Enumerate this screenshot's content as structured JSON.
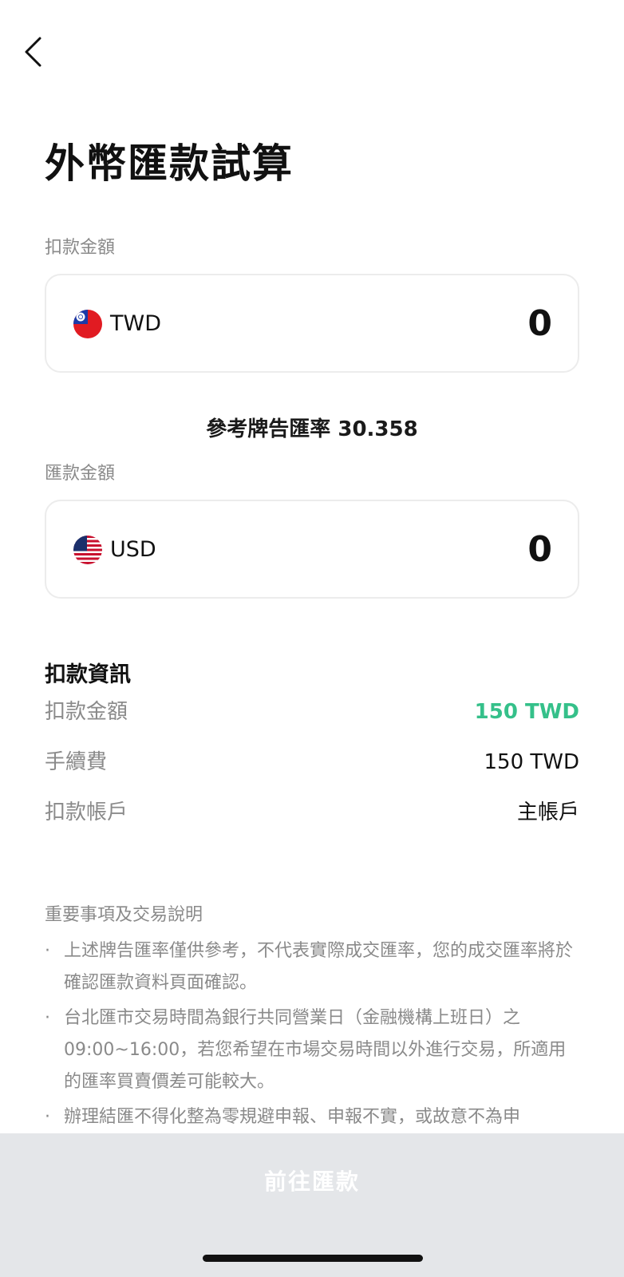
{
  "header": {
    "title": "外幣匯款試算"
  },
  "debit": {
    "label": "扣款金額",
    "currency": "TWD",
    "amount": "0",
    "flag": "taiwan-flag-icon"
  },
  "rate": {
    "text": "參考牌告匯率 30.358"
  },
  "remit": {
    "label": "匯款金額",
    "currency": "USD",
    "amount": "0",
    "flag": "usa-flag-icon"
  },
  "debit_info": {
    "heading": "扣款資訊",
    "rows": [
      {
        "label": "扣款金額",
        "value": "150 TWD"
      },
      {
        "label": "手續費",
        "value": "150 TWD"
      },
      {
        "label": "扣款帳戶",
        "value": "主帳戶"
      }
    ]
  },
  "notes": {
    "title": "重要事項及交易說明",
    "bullet": "·",
    "items": [
      "上述牌告匯率僅供參考，不代表實際成交匯率，您的成交匯率將於確認匯款資料頁面確認。",
      "台北匯市交易時間為銀行共同營業日（金融機構上班日）之09:00~16:00，若您希望在市場交易時間以外進行交易，所適用的匯率買賣價差可能較大。",
      "辦理結匯不得化整為零規避申報、申報不實，或故意不為申"
    ]
  },
  "footer": {
    "button_label": "前往匯款"
  },
  "colors": {
    "accent": "#35c08a",
    "button_bar": "#e4e6e9"
  }
}
